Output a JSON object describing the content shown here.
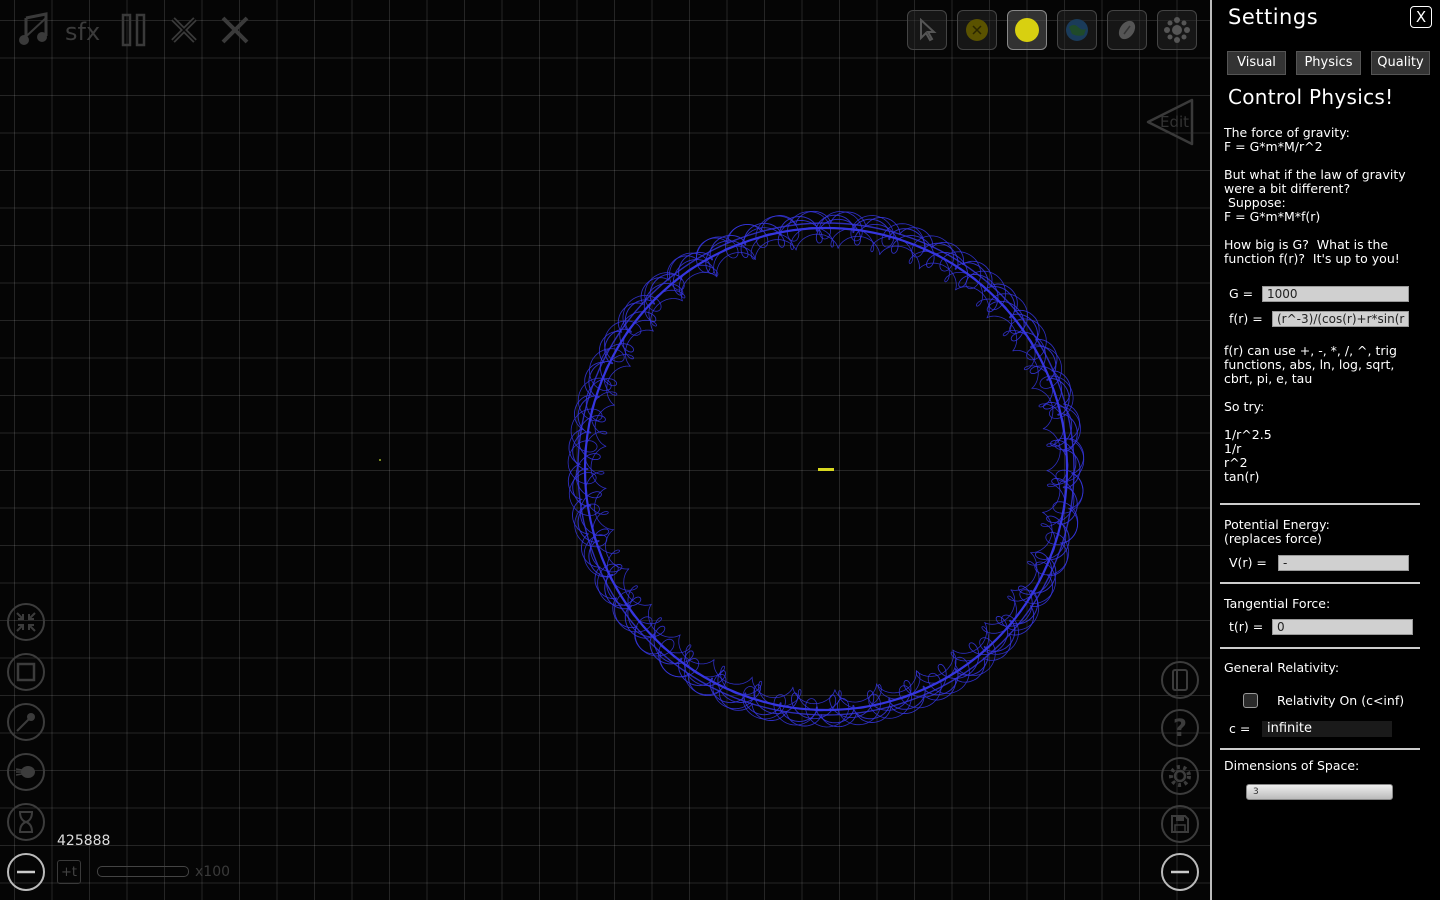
{
  "toolbar": {
    "sfx_label": "sfx"
  },
  "canvas": {
    "edit_label": "Edit",
    "step_counter": "425888",
    "speed_label": "x100",
    "orbit_color": "#3636e0",
    "star_color": "#d8d820"
  },
  "settings": {
    "title": "Settings",
    "close_label": "X",
    "tabs": [
      {
        "label": "Visual"
      },
      {
        "label": "Physics"
      },
      {
        "label": "Quality"
      }
    ],
    "heading": "Control Physics!",
    "intro_text": "The force of gravity:\nF = G*m*M/r^2\n\nBut what if the law of gravity\nwere a bit different?\n Suppose:\nF = G*m*M*f(r)\n\nHow big is G?  What is the\nfunction f(r)?  It's up to you!",
    "g_label": "G =",
    "g_value": "1000",
    "fr_label": "f(r) =",
    "fr_value": "(r^-3)/(cos(r)+r*sin(r",
    "ops_text": "f(r) can use +, -, *, /, ^, trig\nfunctions, abs, ln, log, sqrt,\ncbrt, pi, e, tau",
    "try_text": "So try:\n\n1/r^2.5\n1/r\nr^2\ntan(r)",
    "potential_text": "Potential Energy:\n(replaces force)",
    "vr_label": "V(r) =",
    "vr_value": "-",
    "tangential_text": "Tangential Force:",
    "tr_label": "t(r) =",
    "tr_value": "0",
    "relativity_text": "General Relativity:",
    "relativity_checkbox_label": "Relativity On (c<inf)",
    "c_label": "c =",
    "c_value": "infinite",
    "dimensions_text": "Dimensions of Space:",
    "dimensions_value": "3"
  }
}
